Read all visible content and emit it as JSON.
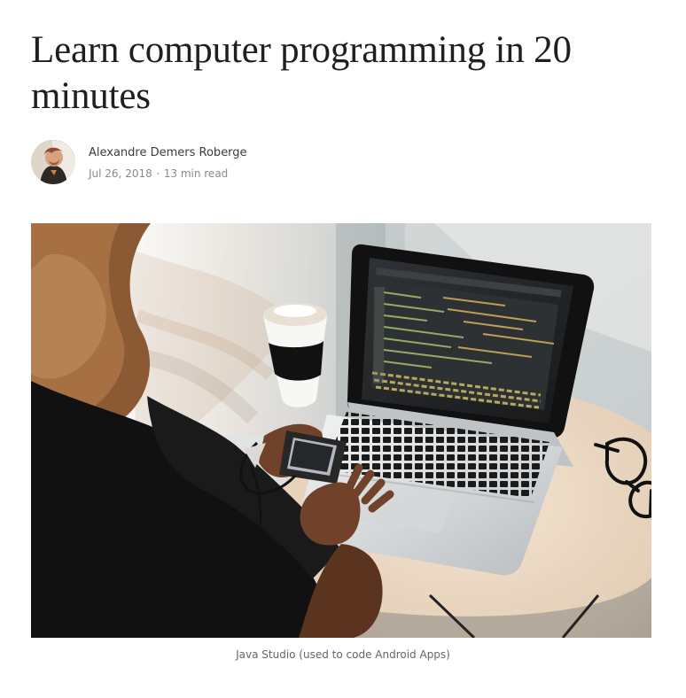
{
  "article": {
    "title": "Learn computer programming in 20 minutes",
    "author": {
      "name": "Alexandre Demers Roberge",
      "date": "Jul 26, 2018",
      "separator": "·",
      "read_time": "13 min read"
    },
    "figure": {
      "image_name": "woman-laptop-coding-photo",
      "caption": "Java Studio (used to code Android Apps)"
    }
  },
  "colors": {
    "title": "#1f1f1f",
    "author": "#3c3c3c",
    "meta": "#8b8b8b",
    "caption": "#666666",
    "background": "#ffffff"
  }
}
